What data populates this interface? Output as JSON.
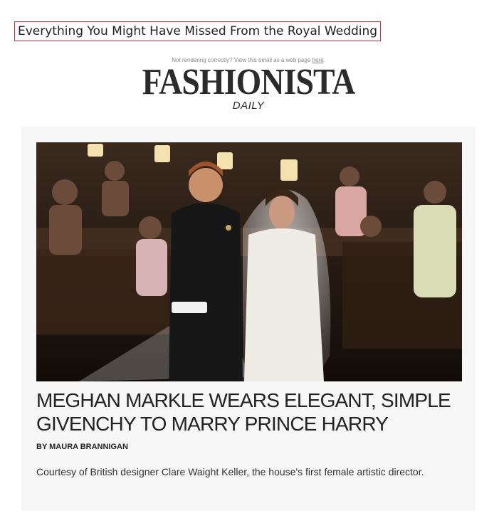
{
  "email": {
    "subject": "Everything You Might Have Missed From the Royal Wedding",
    "web_view_text": "Not rendering correctly? View this email as a web page",
    "web_view_link": "here",
    "brand_logo": "FASHIONISTA",
    "brand_sub": "DAILY"
  },
  "article": {
    "image_alt": "Prince Harry and Meghan Markle at the altar during the royal wedding ceremony",
    "headline": "MEGHAN MARKLE WEARS ELEGANT, SIMPLE GIVENCHY TO MARRY PRINCE HARRY",
    "byline": "BY MAURA BRANNIGAN",
    "deck": "Courtesy of British designer Clare Waight Keller, the house's first female artistic director."
  },
  "colors": {
    "subject_border": "#c9303a",
    "card_bg": "#f6f6f6",
    "text_dark": "#222222"
  }
}
